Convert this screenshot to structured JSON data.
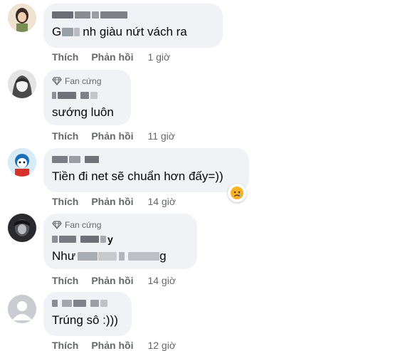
{
  "badge_label": "Fan cứng",
  "actions": {
    "like": "Thích",
    "reply": "Phản hồi"
  },
  "comments": [
    {
      "text_prefix": "G",
      "text_suffix": "nh giàu nứt vách ra",
      "time": "1 giờ"
    },
    {
      "text": "sướng luôn",
      "time": "11 giờ"
    },
    {
      "text": "Tiền đi net sẽ chuẩn hơn đấy=))",
      "time": "14 giờ",
      "reaction": "sad-face-icon"
    },
    {
      "name_suffix": "y",
      "text_prefix": "Như",
      "text_suffix": "g",
      "time": "14 giờ"
    },
    {
      "text": "Trúng sô :)))",
      "time": "12 giờ"
    }
  ],
  "colors": {
    "bubble": "#f0f2f5",
    "meta": "#65676b",
    "text": "#050505",
    "reaction": "#f7b125"
  }
}
